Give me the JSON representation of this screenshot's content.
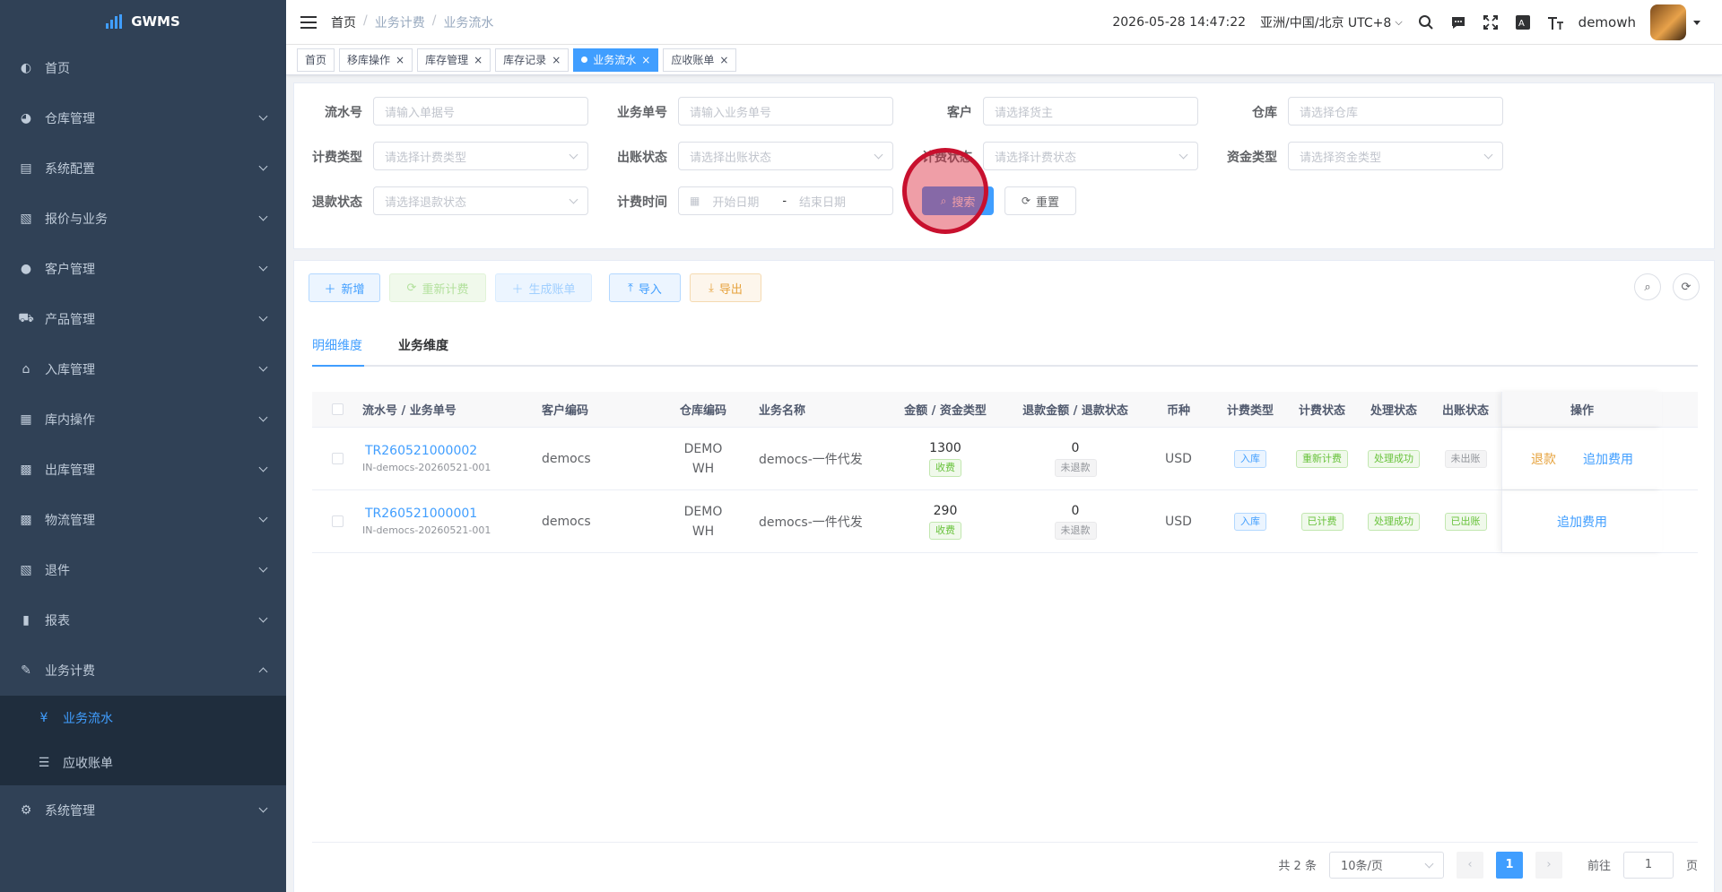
{
  "app": {
    "name": "GWMS"
  },
  "sidebar": {
    "items": [
      {
        "label": "首页",
        "icon": "dashboard-icon",
        "glyph": "◐",
        "expandable": false
      },
      {
        "label": "仓库管理",
        "icon": "warehouse-icon",
        "glyph": "◕",
        "expandable": true
      },
      {
        "label": "系统配置",
        "icon": "config-icon",
        "glyph": "▤",
        "expandable": true
      },
      {
        "label": "报价与业务",
        "icon": "quote-icon",
        "glyph": "▧",
        "expandable": true
      },
      {
        "label": "客户管理",
        "icon": "user-icon",
        "glyph": "●",
        "expandable": true
      },
      {
        "label": "产品管理",
        "icon": "cart-icon",
        "glyph": "⛟",
        "expandable": true
      },
      {
        "label": "入库管理",
        "icon": "home-icon",
        "glyph": "⌂",
        "expandable": true
      },
      {
        "label": "库内操作",
        "icon": "grid-icon",
        "glyph": "▦",
        "expandable": true
      },
      {
        "label": "出库管理",
        "icon": "apps-icon",
        "glyph": "▩",
        "expandable": true
      },
      {
        "label": "物流管理",
        "icon": "apps-icon",
        "glyph": "▩",
        "expandable": true
      },
      {
        "label": "退件",
        "icon": "return-icon",
        "glyph": "▧",
        "expandable": true
      },
      {
        "label": "报表",
        "icon": "bar-chart-icon",
        "glyph": "▮",
        "expandable": true
      },
      {
        "label": "业务计费",
        "icon": "edit-icon",
        "glyph": "✎",
        "expandable": true,
        "open": true
      }
    ],
    "billing_sub": [
      {
        "label": "业务流水",
        "icon": "yen-icon",
        "glyph": "¥",
        "active": true
      },
      {
        "label": "应收账单",
        "icon": "list-icon",
        "glyph": "☰",
        "active": false
      }
    ],
    "last_item": {
      "label": "系统管理",
      "icon": "gear-icon",
      "glyph": "⚙"
    }
  },
  "header": {
    "breadcrumb": [
      "首页",
      "业务计费",
      "业务流水"
    ],
    "datetime": "2026-05-28 14:47:22",
    "timezone": "亚洲/中国/北京 UTC+8",
    "username": "demowh"
  },
  "tags": [
    {
      "label": "首页",
      "closable": false,
      "active": false
    },
    {
      "label": "移库操作",
      "closable": true,
      "active": false
    },
    {
      "label": "库存管理",
      "closable": true,
      "active": false
    },
    {
      "label": "库存记录",
      "closable": true,
      "active": false
    },
    {
      "label": "业务流水",
      "closable": true,
      "active": true
    },
    {
      "label": "应收账单",
      "closable": true,
      "active": false
    }
  ],
  "filters": {
    "serial_no": {
      "label": "流水号",
      "placeholder": "请输入单据号"
    },
    "business_no": {
      "label": "业务单号",
      "placeholder": "请输入业务单号"
    },
    "customer": {
      "label": "客户",
      "placeholder": "请选择货主"
    },
    "warehouse": {
      "label": "仓库",
      "placeholder": "请选择仓库"
    },
    "billing_type": {
      "label": "计费类型",
      "placeholder": "请选择计费类型"
    },
    "billed_status": {
      "label": "出账状态",
      "placeholder": "请选择出账状态"
    },
    "billing_status": {
      "label": "计费状态",
      "placeholder": "请选择计费状态"
    },
    "fund_type": {
      "label": "资金类型",
      "placeholder": "请选择资金类型"
    },
    "refund_status": {
      "label": "退款状态",
      "placeholder": "请选择退款状态"
    },
    "billing_time": {
      "label": "计费时间",
      "start": "开始日期",
      "sep": "-",
      "end": "结束日期"
    },
    "search_label": "搜索",
    "reset_label": "重置"
  },
  "toolbar": {
    "add": "新增",
    "rebill": "重新计费",
    "gen_bill": "生成账单",
    "import": "导入",
    "export": "导出"
  },
  "tabs": [
    "明细维度",
    "业务维度"
  ],
  "table": {
    "headers": {
      "serial": "流水号 / 业务单号",
      "customer_code": "客户编码",
      "warehouse_code": "仓库编码",
      "business_name": "业务名称",
      "amount": "金额 / 资金类型",
      "refund": "退款金额 / 退款状态",
      "currency": "币种",
      "billing_type": "计费类型",
      "billing_status": "计费状态",
      "process_status": "处理状态",
      "billed_status": "出账状态",
      "ops": "操作"
    },
    "rows": [
      {
        "serial": "TR260521000002",
        "business_no": "IN-democs-20260521-001",
        "customer_code": "democs",
        "warehouse_code": "DEMOWH",
        "business_name": "democs-一件代发",
        "amount": "1300",
        "fund_type": "收费",
        "refund_amount": "0",
        "refund_status": "未退款",
        "currency": "USD",
        "billing_type": "入库",
        "billing_status": "重新计费",
        "process_status": "处理成功",
        "billed_status": "未出账",
        "op1": "退款",
        "op2": "追加费用"
      },
      {
        "serial": "TR260521000001",
        "business_no": "IN-democs-20260521-001",
        "customer_code": "democs",
        "warehouse_code": "DEMOWH",
        "business_name": "democs-一件代发",
        "amount": "290",
        "fund_type": "收费",
        "refund_amount": "0",
        "refund_status": "未退款",
        "currency": "USD",
        "billing_type": "入库",
        "billing_status": "已计费",
        "process_status": "处理成功",
        "billed_status": "已出账",
        "op1": "",
        "op2": "追加费用"
      }
    ]
  },
  "pagination": {
    "total": "共 2 条",
    "page_size": "10条/页",
    "current": "1",
    "goto_label": "前往",
    "goto_value": "1",
    "page_unit": "页"
  },
  "colors": {
    "primary": "#409eff",
    "sidebar_bg": "#304156",
    "success": "#67c23a",
    "warning": "#e6a23c"
  }
}
